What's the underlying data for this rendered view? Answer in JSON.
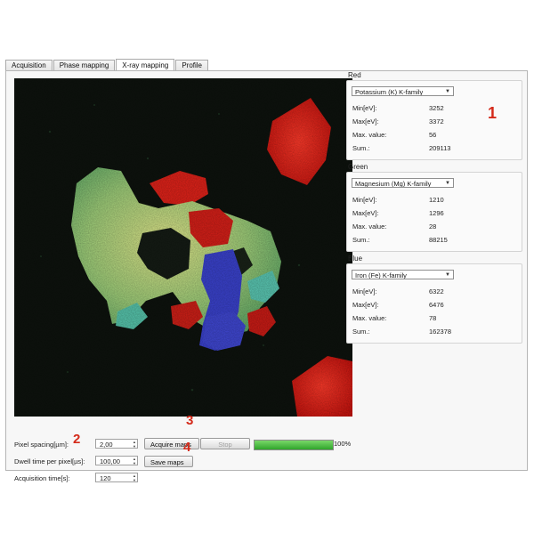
{
  "tabs": [
    "Acquisition",
    "Phase mapping",
    "X-ray mapping",
    "Profile"
  ],
  "active_tab": "X-ray mapping",
  "channels": [
    {
      "title": "Red",
      "color": "#e02418",
      "element": "Potassium (K) K-family",
      "rows": [
        {
          "label": "Min[eV]:",
          "value": "3252"
        },
        {
          "label": "Max[eV]:",
          "value": "3372"
        },
        {
          "label": "Max. value:",
          "value": "56"
        },
        {
          "label": "Sum.:",
          "value": "209113"
        }
      ]
    },
    {
      "title": "Green",
      "color": "#3bd63b",
      "element": "Magnesium (Mg) K-family",
      "rows": [
        {
          "label": "Min[eV]:",
          "value": "1210"
        },
        {
          "label": "Max[eV]:",
          "value": "1296"
        },
        {
          "label": "Max. value:",
          "value": "28"
        },
        {
          "label": "Sum.:",
          "value": "88215"
        }
      ]
    },
    {
      "title": "Blue",
      "color": "#3a46d8",
      "element": "Iron (Fe) K-family",
      "rows": [
        {
          "label": "Min[eV]:",
          "value": "6322"
        },
        {
          "label": "Max[eV]:",
          "value": "6476"
        },
        {
          "label": "Max. value:",
          "value": "78"
        },
        {
          "label": "Sum.:",
          "value": "162378"
        }
      ]
    }
  ],
  "controls": {
    "pixel_spacing_label": "Pixel spacing[µm]:",
    "pixel_spacing_value": "2,00",
    "dwell_time_label": "Dwell time per pixel[µs]:",
    "dwell_time_value": "100,00",
    "acq_time_label": "Acquisition time[s]:",
    "acq_time_value": "120",
    "acquire_button": "Acquire maps",
    "stop_button": "Stop",
    "save_button": "Save maps",
    "progress_percent": 100,
    "progress_label": "100%"
  },
  "markers": {
    "m1": "1",
    "m2": "2",
    "m3": "3",
    "m4": "4"
  }
}
